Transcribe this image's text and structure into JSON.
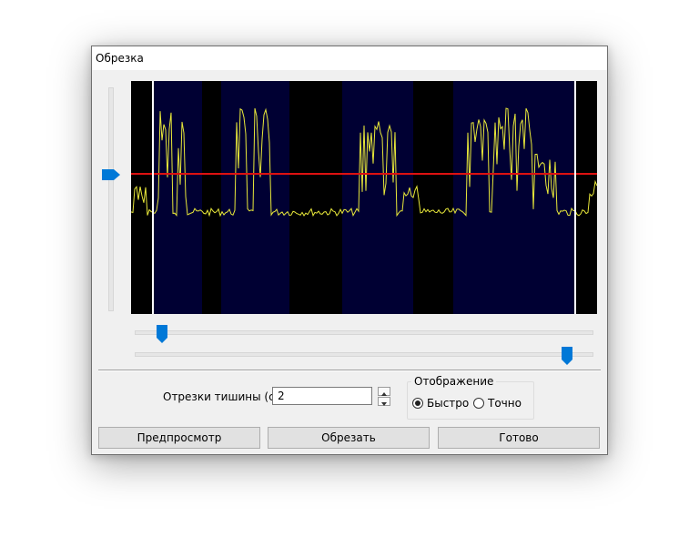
{
  "window": {
    "title": "Обрезка"
  },
  "waveform": {
    "background_color": "#000000",
    "region_color": "#000033",
    "wave_color": "#e8e83a",
    "threshold_color": "#dd1111",
    "marker_color": "#ffffff"
  },
  "controls": {
    "silence_label": "Отрезки тишины (с):",
    "silence_value": "2"
  },
  "display_group": {
    "title": "Отображение",
    "options": [
      {
        "label": "Быстро",
        "selected": true
      },
      {
        "label": "Точно",
        "selected": false
      }
    ]
  },
  "buttons": {
    "preview": "Предпросмотр",
    "trim": "Обрезать",
    "done": "Готово"
  },
  "accent_color": "#0078d7"
}
